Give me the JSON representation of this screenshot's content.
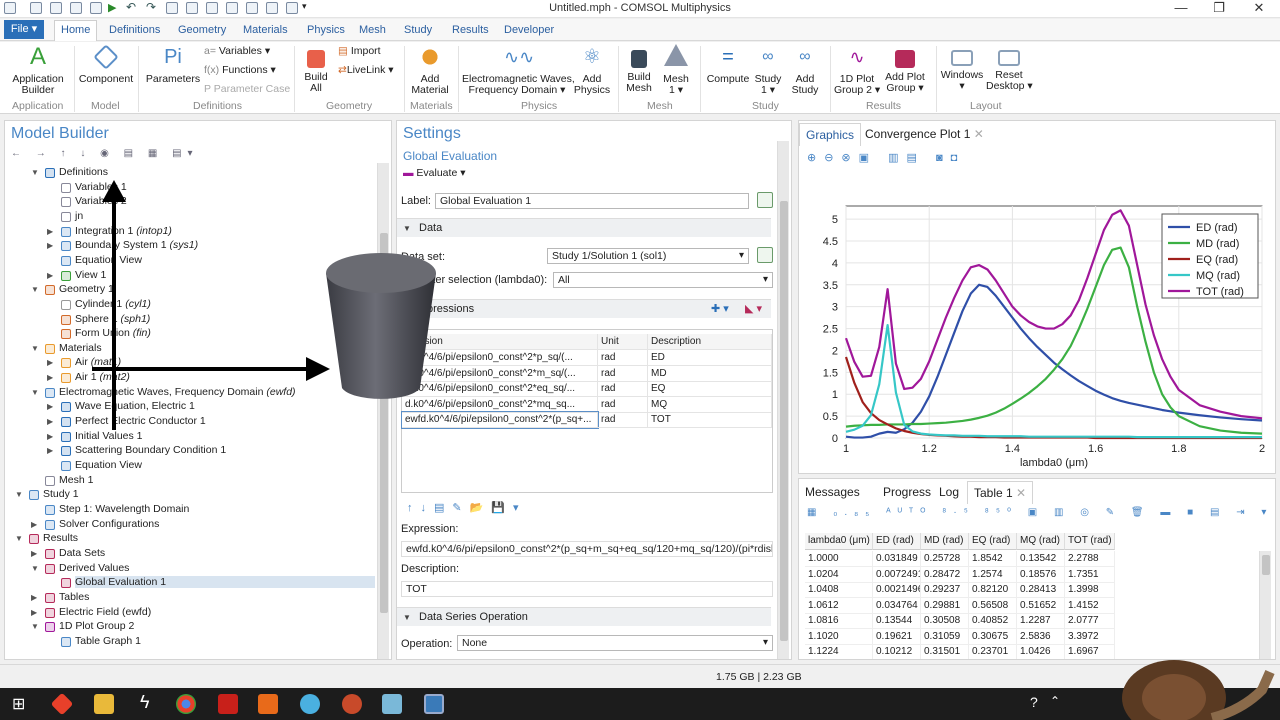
{
  "window": {
    "title": "Untitled.mph - COMSOL Multiphysics"
  },
  "ribbon_tabs": [
    "Home",
    "Definitions",
    "Geometry",
    "Materials",
    "Physics",
    "Mesh",
    "Study",
    "Results",
    "Developer"
  ],
  "file_tab": "File ▾",
  "ribbon": {
    "application_builder": "Application\nBuilder",
    "component": "Component",
    "parameters": "Parameters",
    "variables": "Variables ▾",
    "functions": "Functions ▾",
    "parameter_case": "Parameter Case",
    "build_all": "Build\nAll",
    "import": "Import",
    "livelink": "LiveLink ▾",
    "add_material": "Add\nMaterial",
    "em_waves": "Electromagnetic Waves,\nFrequency Domain ▾",
    "add_physics": "Add\nPhysics",
    "build_mesh": "Build\nMesh",
    "mesh1": "Mesh\n1 ▾",
    "compute": "Compute",
    "study1": "Study\n1 ▾",
    "add_study": "Add\nStudy",
    "plot_group": "1D Plot\nGroup 2 ▾",
    "add_plot_group": "Add Plot\nGroup ▾",
    "windows": "Windows\n▾",
    "reset_desktop": "Reset\nDesktop ▾",
    "groups": [
      "Application",
      "Model",
      "Definitions",
      "Geometry",
      "Materials",
      "Physics",
      "Mesh",
      "Study",
      "Results",
      "Layout"
    ]
  },
  "model_builder": {
    "title": "Model Builder",
    "tree": [
      {
        "label": "Definitions",
        "suffix": ""
      },
      {
        "label": "Variables 1",
        "suffix": ""
      },
      {
        "label": "Variables 2",
        "suffix": ""
      },
      {
        "label": "jn",
        "suffix": ""
      },
      {
        "label": "Integration 1",
        "suffix": "(intop1)"
      },
      {
        "label": "Boundary System 1",
        "suffix": "(sys1)"
      },
      {
        "label": "Equation View",
        "suffix": ""
      },
      {
        "label": "View 1",
        "suffix": ""
      },
      {
        "label": "Geometry 1",
        "suffix": ""
      },
      {
        "label": "Cylinder 1",
        "suffix": "(cyl1)"
      },
      {
        "label": "Sphere 1",
        "suffix": "(sph1)"
      },
      {
        "label": "Form Union",
        "suffix": "(fin)"
      },
      {
        "label": "Materials",
        "suffix": ""
      },
      {
        "label": "Air",
        "suffix": "(mat1)"
      },
      {
        "label": "Air 1",
        "suffix": "(mat2)"
      },
      {
        "label": "Electromagnetic Waves, Frequency Domain",
        "suffix": "(ewfd)"
      },
      {
        "label": "Wave Equation, Electric 1",
        "suffix": ""
      },
      {
        "label": "Perfect Electric Conductor 1",
        "suffix": ""
      },
      {
        "label": "Initial Values 1",
        "suffix": ""
      },
      {
        "label": "Scattering Boundary Condition 1",
        "suffix": ""
      },
      {
        "label": "Equation View",
        "suffix": ""
      },
      {
        "label": "Mesh 1",
        "suffix": ""
      },
      {
        "label": "Study 1",
        "suffix": ""
      },
      {
        "label": "Step 1: Wavelength Domain",
        "suffix": ""
      },
      {
        "label": "Solver Configurations",
        "suffix": ""
      },
      {
        "label": "Results",
        "suffix": ""
      },
      {
        "label": "Data Sets",
        "suffix": ""
      },
      {
        "label": "Derived Values",
        "suffix": ""
      },
      {
        "label": "Global Evaluation 1",
        "suffix": ""
      },
      {
        "label": "Tables",
        "suffix": ""
      },
      {
        "label": "Electric Field (ewfd)",
        "suffix": ""
      },
      {
        "label": "1D Plot Group 2",
        "suffix": ""
      },
      {
        "label": "Table Graph 1",
        "suffix": ""
      }
    ]
  },
  "settings": {
    "title": "Settings",
    "subtitle": "Global Evaluation",
    "evaluate": "Evaluate ▾",
    "label_caption": "Label:",
    "label_value": "Global Evaluation 1",
    "data_section": "Data",
    "dataset_caption": "Data set:",
    "dataset_value": "Study 1/Solution 1 (sol1)",
    "param_caption": "meter selection (lambda0):",
    "param_value": "All",
    "expressions_section": "pressions",
    "columns": [
      "pression",
      "Unit",
      "Description"
    ],
    "rows": [
      {
        "expr": "d.k0^4/6/pi/epsilon0_const^2*p_sq/(...",
        "unit": "rad",
        "desc": "ED"
      },
      {
        "expr": "d.k0^4/6/pi/epsilon0_const^2*m_sq/(...",
        "unit": "rad",
        "desc": "MD"
      },
      {
        "expr": "d.k0^4/6/pi/epsilon0_const^2*eq_sq/...",
        "unit": "rad",
        "desc": "EQ"
      },
      {
        "expr": "d.k0^4/6/pi/epsilon0_const^2*mq_sq...",
        "unit": "rad",
        "desc": "MQ"
      },
      {
        "expr": "ewfd.k0^4/6/pi/epsilon0_const^2*(p_sq+...",
        "unit": "rad",
        "desc": "TOT"
      }
    ],
    "expression_caption": "Expression:",
    "expression_value": "ewfd.k0^4/6/pi/epsilon0_const^2*(p_sq+m_sq+eq_sq/120+mq_sq/120)/(pi*rdisk^2",
    "description_caption": "Description:",
    "description_value": "TOT",
    "dso_section": "Data Series Operation",
    "operation_caption": "Operation:",
    "operation_value": "None"
  },
  "graphics": {
    "tabs": [
      "Graphics",
      "Convergence Plot 1"
    ]
  },
  "chart_data": {
    "type": "line",
    "xlabel": "lambda0 (μm)",
    "ylabel": "",
    "xlim": [
      1.0,
      2.0
    ],
    "ylim": [
      0,
      5.3
    ],
    "xticks": [
      1,
      1.2,
      1.4,
      1.6,
      1.8,
      2
    ],
    "yticks": [
      0,
      0.5,
      1,
      1.5,
      2,
      2.5,
      3,
      3.5,
      4,
      4.5,
      5
    ],
    "grid": true,
    "legend": "top-right",
    "x": [
      1.0,
      1.02,
      1.04,
      1.06,
      1.08,
      1.1,
      1.12,
      1.14,
      1.16,
      1.18,
      1.2,
      1.22,
      1.24,
      1.26,
      1.28,
      1.3,
      1.32,
      1.34,
      1.36,
      1.38,
      1.4,
      1.42,
      1.44,
      1.46,
      1.48,
      1.5,
      1.52,
      1.54,
      1.56,
      1.58,
      1.6,
      1.62,
      1.64,
      1.66,
      1.68,
      1.7,
      1.72,
      1.74,
      1.76,
      1.78,
      1.8,
      1.85,
      1.9,
      1.95,
      2.0
    ],
    "series": [
      {
        "name": "ED (rad)",
        "color": "#2f4fa8",
        "values": [
          0.03,
          0.01,
          0.01,
          0.03,
          0.1,
          0.14,
          0.12,
          0.2,
          0.35,
          0.6,
          0.95,
          1.4,
          1.9,
          2.4,
          2.9,
          3.3,
          3.5,
          3.45,
          3.25,
          3.0,
          2.75,
          2.5,
          2.28,
          2.08,
          1.9,
          1.72,
          1.57,
          1.43,
          1.3,
          1.19,
          1.08,
          0.99,
          0.91,
          0.85,
          0.8,
          0.76,
          0.72,
          0.68,
          0.64,
          0.61,
          0.58,
          0.52,
          0.47,
          0.43,
          0.4
        ]
      },
      {
        "name": "MD (rad)",
        "color": "#3cb043",
        "values": [
          0.26,
          0.28,
          0.29,
          0.3,
          0.3,
          0.31,
          0.31,
          0.31,
          0.32,
          0.32,
          0.33,
          0.34,
          0.35,
          0.37,
          0.39,
          0.42,
          0.46,
          0.51,
          0.58,
          0.67,
          0.78,
          0.9,
          1.03,
          1.18,
          1.35,
          1.56,
          1.8,
          2.1,
          2.5,
          2.95,
          3.45,
          3.95,
          4.3,
          4.35,
          3.9,
          3.0,
          2.2,
          1.5,
          1.0,
          0.7,
          0.5,
          0.27,
          0.17,
          0.12,
          0.1
        ]
      },
      {
        "name": "EQ (rad)",
        "color": "#a0201c",
        "values": [
          1.85,
          1.26,
          0.82,
          0.57,
          0.41,
          0.31,
          0.22,
          0.16,
          0.12,
          0.09,
          0.07,
          0.06,
          0.05,
          0.04,
          0.03,
          0.03,
          0.02,
          0.02,
          0.02,
          0.01,
          0.01,
          0.01,
          0.01,
          0.01,
          0.01,
          0.01,
          0.01,
          0.01,
          0.01,
          0.01,
          0.0,
          0.0,
          0.0,
          0.0,
          0.0,
          0.0,
          0.0,
          0.0,
          0.0,
          0.0,
          0.0,
          0.0,
          0.0,
          0.0,
          0.0
        ]
      },
      {
        "name": "MQ (rad)",
        "color": "#36c7c7",
        "values": [
          0.14,
          0.19,
          0.28,
          0.52,
          1.23,
          2.58,
          1.04,
          0.3,
          0.15,
          0.1,
          0.08,
          0.07,
          0.06,
          0.06,
          0.05,
          0.05,
          0.05,
          0.04,
          0.04,
          0.04,
          0.04,
          0.04,
          0.03,
          0.03,
          0.03,
          0.03,
          0.03,
          0.03,
          0.03,
          0.03,
          0.03,
          0.03,
          0.03,
          0.03,
          0.03,
          0.02,
          0.02,
          0.02,
          0.02,
          0.02,
          0.02,
          0.02,
          0.02,
          0.02,
          0.02
        ]
      },
      {
        "name": "TOT (rad)",
        "color": "#a0179a",
        "values": [
          2.28,
          1.74,
          1.4,
          1.42,
          2.08,
          3.4,
          1.7,
          1.12,
          1.15,
          1.35,
          1.75,
          2.25,
          2.75,
          3.2,
          3.6,
          3.9,
          3.95,
          3.85,
          3.6,
          3.3,
          3.0,
          2.8,
          2.65,
          2.55,
          2.5,
          2.5,
          2.6,
          2.8,
          3.15,
          3.65,
          4.2,
          4.75,
          5.1,
          5.2,
          4.85,
          3.95,
          3.05,
          2.35,
          1.8,
          1.4,
          1.1,
          0.75,
          0.6,
          0.5,
          0.45
        ]
      }
    ]
  },
  "bottom_tabs": [
    "Messages",
    "Progress",
    "Log",
    "Table 1"
  ],
  "table": {
    "columns": [
      "lambda0 (μm)",
      "ED (rad)",
      "MD (rad)",
      "EQ (rad)",
      "MQ (rad)",
      "TOT (rad)"
    ],
    "rows": [
      [
        "1.0000",
        "0.031849",
        "0.25728",
        "1.8542",
        "0.13542",
        "2.2788"
      ],
      [
        "1.0204",
        "0.0072491",
        "0.28472",
        "1.2574",
        "0.18576",
        "1.7351"
      ],
      [
        "1.0408",
        "0.0021496",
        "0.29237",
        "0.82120",
        "0.28413",
        "1.3998"
      ],
      [
        "1.0612",
        "0.034764",
        "0.29881",
        "0.56508",
        "0.51652",
        "1.4152"
      ],
      [
        "1.0816",
        "0.13544",
        "0.30508",
        "0.40852",
        "1.2287",
        "2.0777"
      ],
      [
        "1.1020",
        "0.19621",
        "0.31059",
        "0.30675",
        "2.5836",
        "3.3972"
      ],
      [
        "1.1224",
        "0.10212",
        "0.31501",
        "0.23701",
        "1.0426",
        "1.6967"
      ]
    ]
  },
  "status": {
    "memory": "1.75 GB | 2.23 GB"
  }
}
